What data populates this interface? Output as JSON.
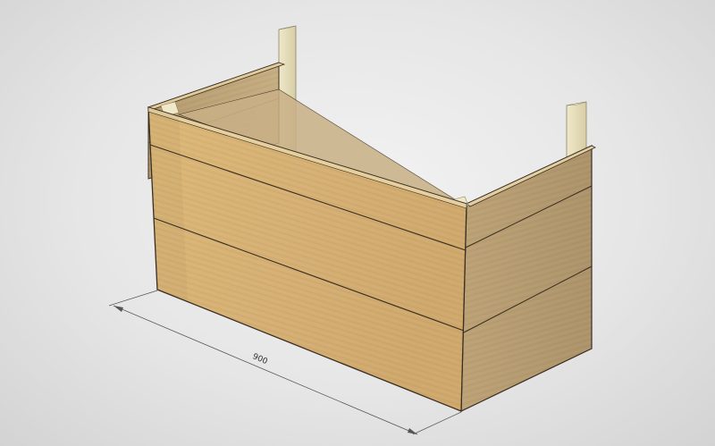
{
  "dimension": {
    "length_label": "900"
  },
  "colors": {
    "background": "#e6e6e6",
    "wood_front": "#d9b57a",
    "wood_side": "#b89d6f",
    "wood_inner": "#cdb48a",
    "post": "#e8e0c0",
    "edge": "#3a2f22",
    "dimension_line": "#555555"
  }
}
